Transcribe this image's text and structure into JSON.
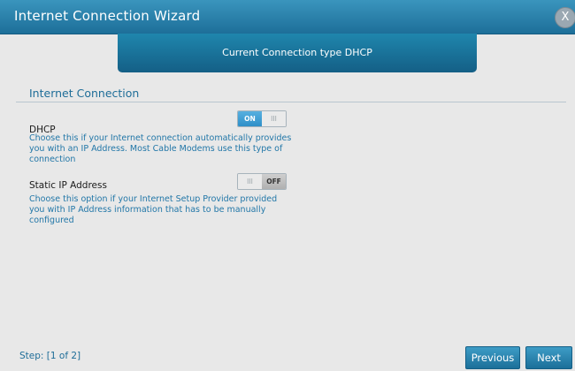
{
  "window": {
    "title": "Internet Connection Wizard",
    "close_label": "X"
  },
  "banner": {
    "text": "Current Connection type DHCP"
  },
  "section": {
    "title": "Internet Connection"
  },
  "options": [
    {
      "label": "DHCP",
      "toggle": {
        "state": "on",
        "on_text": "ON",
        "off_text": "",
        "grip": "III"
      },
      "description": "Choose this if your Internet connection automatically provides you with an IP Address. Most Cable Modems use this type of connection"
    },
    {
      "label": "Static IP Address",
      "toggle": {
        "state": "off",
        "on_text": "",
        "off_text": "OFF",
        "grip": "III"
      },
      "description": "Choose this option if your Internet Setup Provider provided you with IP Address information that has to be manually configured"
    }
  ],
  "footer": {
    "step": "Step: [1 of 2]",
    "previous_label": "Previous",
    "next_label": "Next"
  },
  "colors": {
    "titlebar": "#2a85b0",
    "accent_text": "#2277a8",
    "toggle_on": "#3f9dd2"
  }
}
